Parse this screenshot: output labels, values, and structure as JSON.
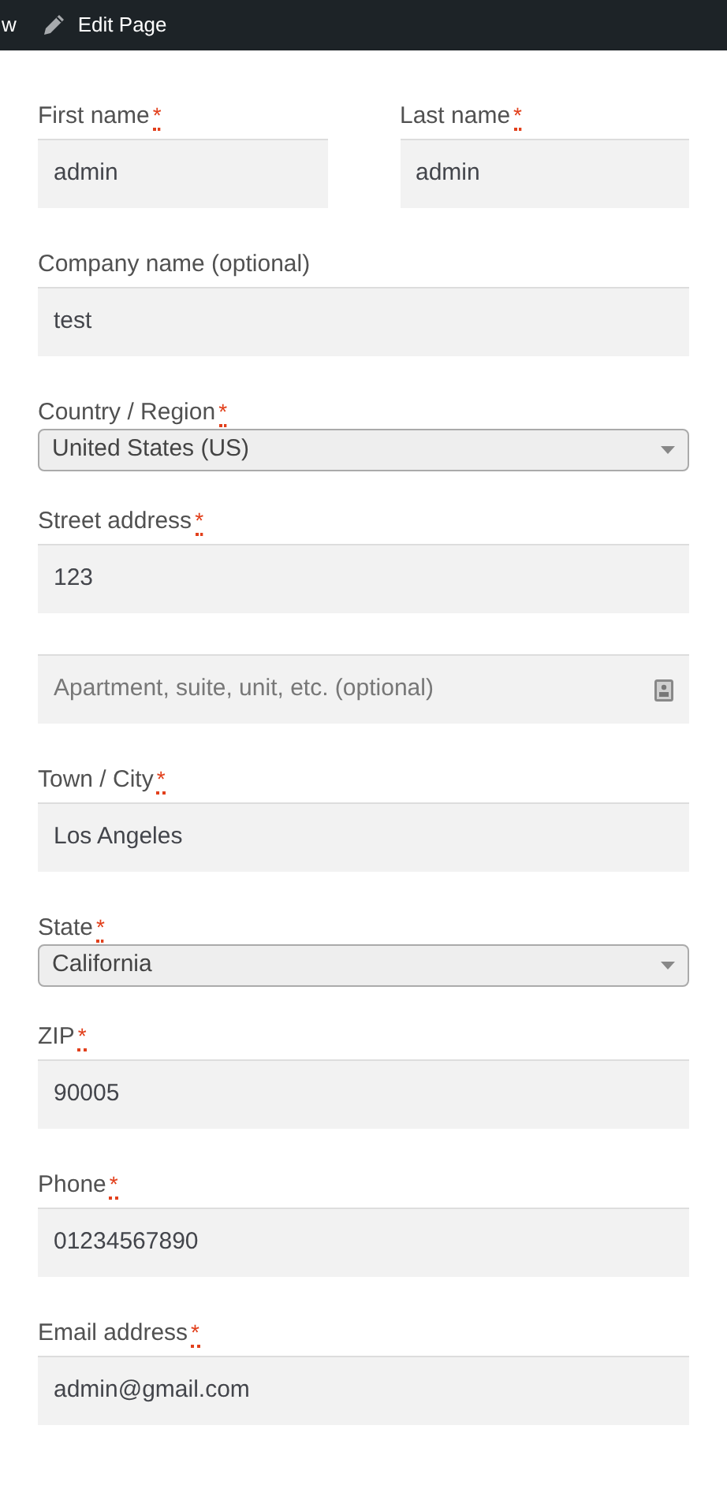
{
  "admin_bar": {
    "cut_item": "w",
    "edit_link": "Edit Page"
  },
  "rows": [
    [
      {
        "kind": "text",
        "label": "First name",
        "required_mark": "*",
        "value": "admin"
      },
      {
        "kind": "text",
        "label": "Last name",
        "required_mark": "*",
        "value": "admin"
      }
    ],
    [
      {
        "kind": "text",
        "label": "Company name (optional)",
        "value": "test"
      }
    ],
    [
      {
        "kind": "select",
        "label": "Country / Region",
        "required_mark": "*",
        "value": "United States (US)"
      }
    ],
    [
      {
        "kind": "text",
        "label": "Street address",
        "required_mark": "*",
        "value": "123"
      }
    ],
    [
      {
        "kind": "text",
        "placeholder": "Apartment, suite, unit, etc. (optional)",
        "autofill_icon": true
      }
    ],
    [
      {
        "kind": "text",
        "label": "Town / City",
        "required_mark": "*",
        "value": "Los Angeles"
      }
    ],
    [
      {
        "kind": "select",
        "label": "State",
        "required_mark": "*",
        "value": "California"
      }
    ],
    [
      {
        "kind": "text",
        "label": "ZIP",
        "required_mark": "*",
        "value": "90005"
      }
    ],
    [
      {
        "kind": "text",
        "label": "Phone",
        "required_mark": "*",
        "value": "01234567890"
      }
    ],
    [
      {
        "kind": "text",
        "label": "Email address",
        "required_mark": "*",
        "value": "admin@gmail.com"
      }
    ]
  ]
}
